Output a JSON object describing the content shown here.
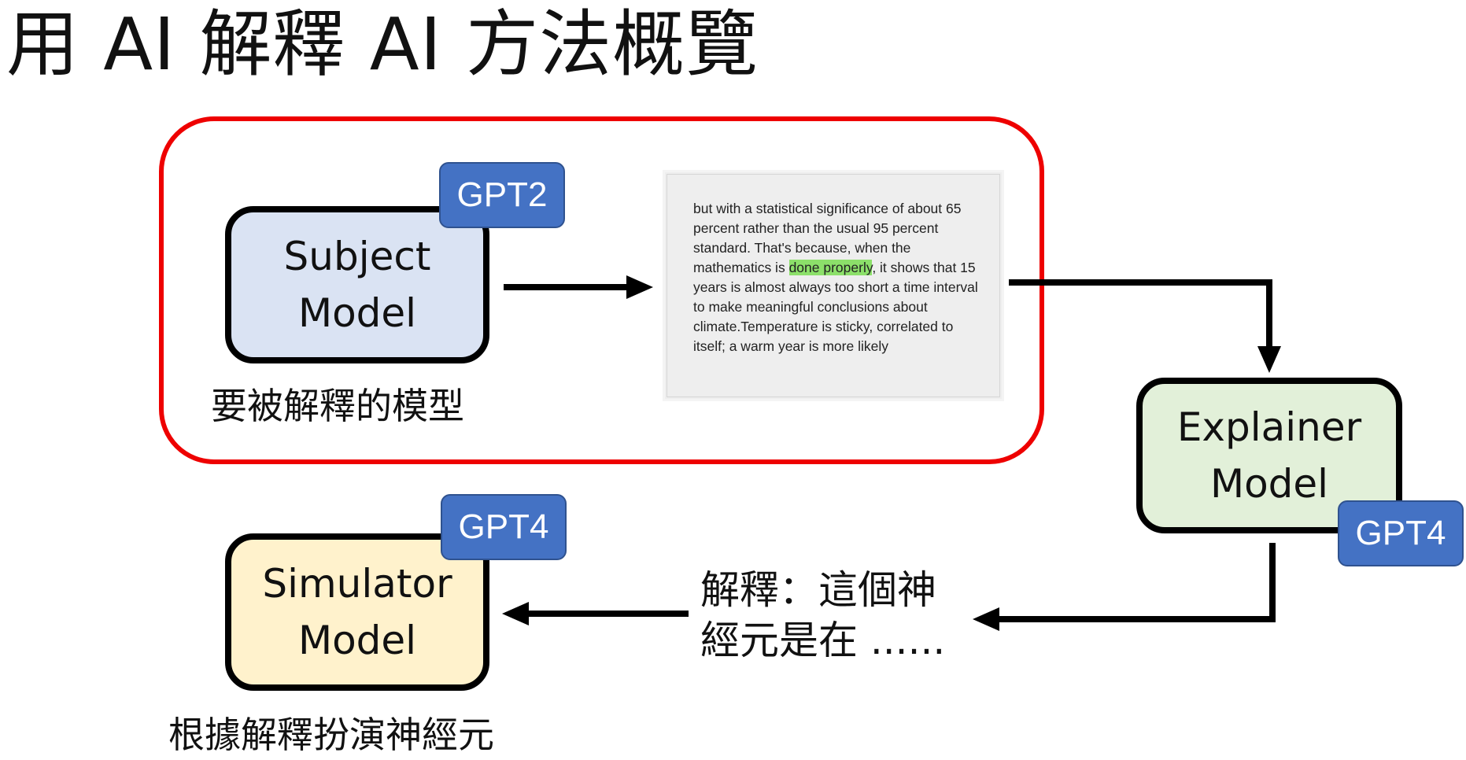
{
  "title": "用 AI 解釋 AI 方法概覽",
  "subject_model": {
    "line1": "Subject",
    "line2": "Model",
    "badge": "GPT2",
    "caption": "要被解釋的模型"
  },
  "explainer_model": {
    "line1": "Explainer",
    "line2": "Model",
    "badge": "GPT4"
  },
  "simulator_model": {
    "line1": "Simulator",
    "line2": "Model",
    "badge": "GPT4",
    "caption": "根據解釋扮演神經元"
  },
  "document": {
    "before_highlight": "but with a statistical significance of about 65 percent rather than the usual 95 percent standard. That's because, when the mathematics is ",
    "highlight_1": "done",
    "between": " ",
    "highlight_2": "properly",
    "after_highlight": ", it shows that 15 years is almost always too short a time interval to make meaningful conclusions about climate.Temperature is sticky, correlated to itself; a warm year is more likely",
    "highlight_color": "#8ce06a"
  },
  "explanation": {
    "line1": "解釋：這個神",
    "line2": "經元是在 ......"
  },
  "colors": {
    "frame": "#ee0000",
    "subject_fill": "#dae3f3",
    "explainer_fill": "#e2f0d9",
    "simulator_fill": "#fff2cc",
    "badge_fill": "#4472c4"
  }
}
